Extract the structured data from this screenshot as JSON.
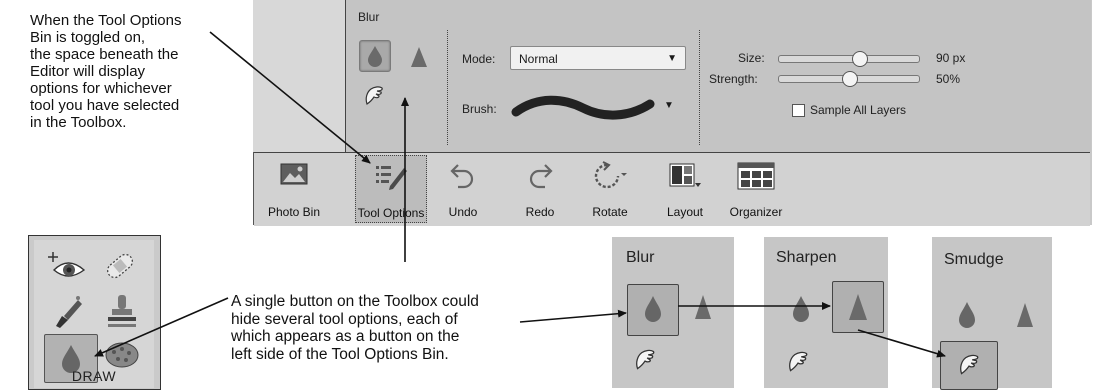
{
  "annotations": {
    "top_left": [
      "When the Tool Options",
      "Bin is toggled on,",
      "the space beneath the",
      "Editor will display",
      "options for whichever",
      "tool you have selected",
      "in the Toolbox."
    ],
    "bottom_center": [
      "A single button on the Toolbox could",
      "hide several tool options, each of",
      "which appears as a button on the",
      "left side of the Tool Options Bin."
    ]
  },
  "tool_options_bin": {
    "tool_name": "Blur",
    "mode_label": "Mode:",
    "mode_value": "Normal",
    "brush_label": "Brush:",
    "size_label": "Size:",
    "size_value": "90 px",
    "size_level": 0.58,
    "strength_label": "Strength:",
    "strength_value": "50%",
    "strength_level": 0.5,
    "sample_all_layers_label": "Sample All Layers",
    "sample_all_layers_checked": false
  },
  "taskbar": {
    "items": [
      {
        "label": "Photo Bin",
        "icon": "photo-bin-icon"
      },
      {
        "label": "Tool Options",
        "icon": "tool-options-icon",
        "active": true
      },
      {
        "label": "Undo",
        "icon": "undo-icon"
      },
      {
        "label": "Redo",
        "icon": "redo-icon"
      },
      {
        "label": "Rotate",
        "icon": "rotate-icon"
      },
      {
        "label": "Layout",
        "icon": "layout-icon"
      },
      {
        "label": "Organizer",
        "icon": "organizer-icon"
      }
    ]
  },
  "toolbox": {
    "section_label": "DRAW",
    "tools": [
      "red-eye-icon",
      "spot-healing-icon",
      "smart-brush-icon",
      "clone-stamp-icon",
      "blur-icon",
      "sponge-icon"
    ]
  },
  "mini_panels": [
    {
      "title": "Blur",
      "selected": "blur"
    },
    {
      "title": "Sharpen",
      "selected": "sharpen"
    },
    {
      "title": "Smudge",
      "selected": "smudge"
    }
  ],
  "colors": {
    "panel_bg": "#c4c4c4",
    "selected_bg": "#a9a9a9",
    "icon_dark": "#6a6a6a"
  }
}
